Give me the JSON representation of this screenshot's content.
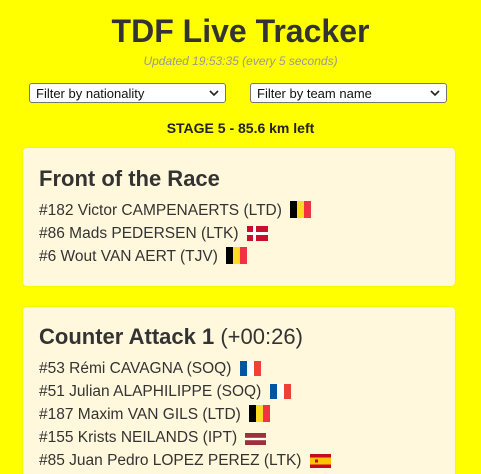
{
  "header": {
    "title": "TDF Live Tracker",
    "updated": "Updated 19:53:35 (every 5 seconds)"
  },
  "filters": {
    "nationality": {
      "selected": "Filter by nationality"
    },
    "team": {
      "selected": "Filter by team name"
    }
  },
  "stage": {
    "text": "STAGE 5 - 85.6 km left"
  },
  "groups": [
    {
      "title": "Front of the Race",
      "gap": "",
      "riders": [
        {
          "text": "#182 Victor CAMPENAERTS (LTD)",
          "flag": "belgium-flag-icon"
        },
        {
          "text": "#86 Mads PEDERSEN (LTK)",
          "flag": "denmark-flag-icon"
        },
        {
          "text": "#6 Wout VAN AERT (TJV)",
          "flag": "belgium-flag-icon"
        }
      ]
    },
    {
      "title": "Counter Attack 1",
      "gap": "(+00:26)",
      "riders": [
        {
          "text": "#53 Rémi CAVAGNA (SOQ)",
          "flag": "france-flag-icon"
        },
        {
          "text": "#51 Julian ALAPHILIPPE (SOQ)",
          "flag": "france-flag-icon"
        },
        {
          "text": "#187 Maxim VAN GILS (LTD)",
          "flag": "belgium-flag-icon"
        },
        {
          "text": "#155 Krists NEILANDS (IPT)",
          "flag": "latvia-flag-icon"
        },
        {
          "text": "#85 Juan Pedro LOPEZ PEREZ (LTK)",
          "flag": "spain-flag-icon"
        }
      ]
    }
  ],
  "colors": {
    "background": "#ffff00",
    "card": "#fff8dc",
    "text": "#333333",
    "muted": "#999999"
  }
}
